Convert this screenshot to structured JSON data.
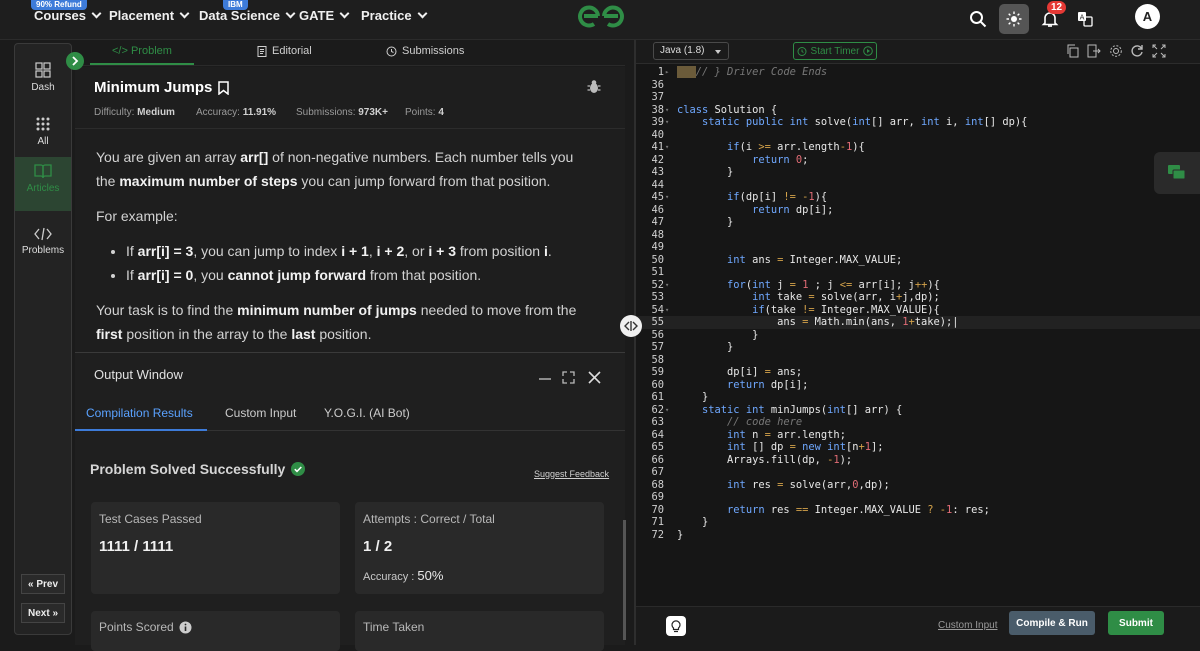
{
  "topnav": {
    "items": [
      {
        "label": "Courses",
        "badge": "90% Refund"
      },
      {
        "label": "Placement",
        "badge": ""
      },
      {
        "label": "Data Science",
        "badge": "IBM"
      },
      {
        "label": "GATE",
        "badge": ""
      },
      {
        "label": "Practice",
        "badge": ""
      }
    ],
    "notification_count": "12",
    "avatar_letter": "A",
    "brand_color": "#2f8d46"
  },
  "rail": {
    "items": [
      {
        "label": "Dash",
        "icon": "dashboard-icon"
      },
      {
        "label": "All",
        "icon": "grid-icon"
      },
      {
        "label": "Articles",
        "icon": "book-icon",
        "active": true
      },
      {
        "label": "Problems",
        "icon": "code-icon"
      }
    ],
    "prev_label": "« Prev",
    "next_label": "Next »"
  },
  "problem_tabs": [
    "</> Problem",
    "Editorial",
    "Submissions"
  ],
  "problem": {
    "title": "Minimum Jumps",
    "difficulty_label": "Difficulty:",
    "difficulty": "Medium",
    "accuracy_label": "Accuracy:",
    "accuracy": "11.91%",
    "submissions_label": "Submissions:",
    "submissions": "973K+",
    "points_label": "Points:",
    "points": "4",
    "p1_a": "You are given an array ",
    "p1_b": "arr[]",
    "p1_c": " of non-negative numbers. Each number tells you the ",
    "p1_d": "maximum number of steps",
    "p1_e": " you can jump forward from that position.",
    "example_label": "For example:",
    "b1_a": "If ",
    "b1_b": "arr[i] = 3",
    "b1_c": ", you can jump to index ",
    "b1_d": "i + 1",
    "b1_e": ", ",
    "b1_f": "i + 2",
    "b1_g": ", or ",
    "b1_h": "i + 3",
    "b1_i": " from position ",
    "b1_j": "i",
    "b1_k": ".",
    "b2_a": "If ",
    "b2_b": "arr[i] = 0",
    "b2_c": ", you ",
    "b2_d": "cannot jump forward",
    "b2_e": " from that position.",
    "p3_a": "Your task is to find the ",
    "p3_b": "minimum number of jumps",
    "p3_c": " needed to move from the ",
    "p3_d": "first",
    "p3_e": " position in the array to the ",
    "p3_f": "last",
    "p3_g": " position."
  },
  "output": {
    "title": "Output Window",
    "tabs": [
      "Compilation Results",
      "Custom Input",
      "Y.O.G.I. (AI Bot)"
    ],
    "status": "Problem Solved Successfully",
    "feedback_link": "Suggest Feedback",
    "cards": [
      {
        "label": "Test Cases Passed",
        "value": "1111 / 1111"
      },
      {
        "label": "Attempts : Correct / Total",
        "value": "1 / 2",
        "sub_label": "Accuracy :",
        "sub_value": "50%"
      },
      {
        "label": "Points Scored",
        "value": ""
      },
      {
        "label": "Time Taken",
        "value": ""
      }
    ]
  },
  "editor": {
    "language": "Java (1.8)",
    "timer_label": "Start Timer",
    "custom_input_link": "Custom Input",
    "compile_button": "Compile & Run",
    "submit_button": "Submit"
  }
}
